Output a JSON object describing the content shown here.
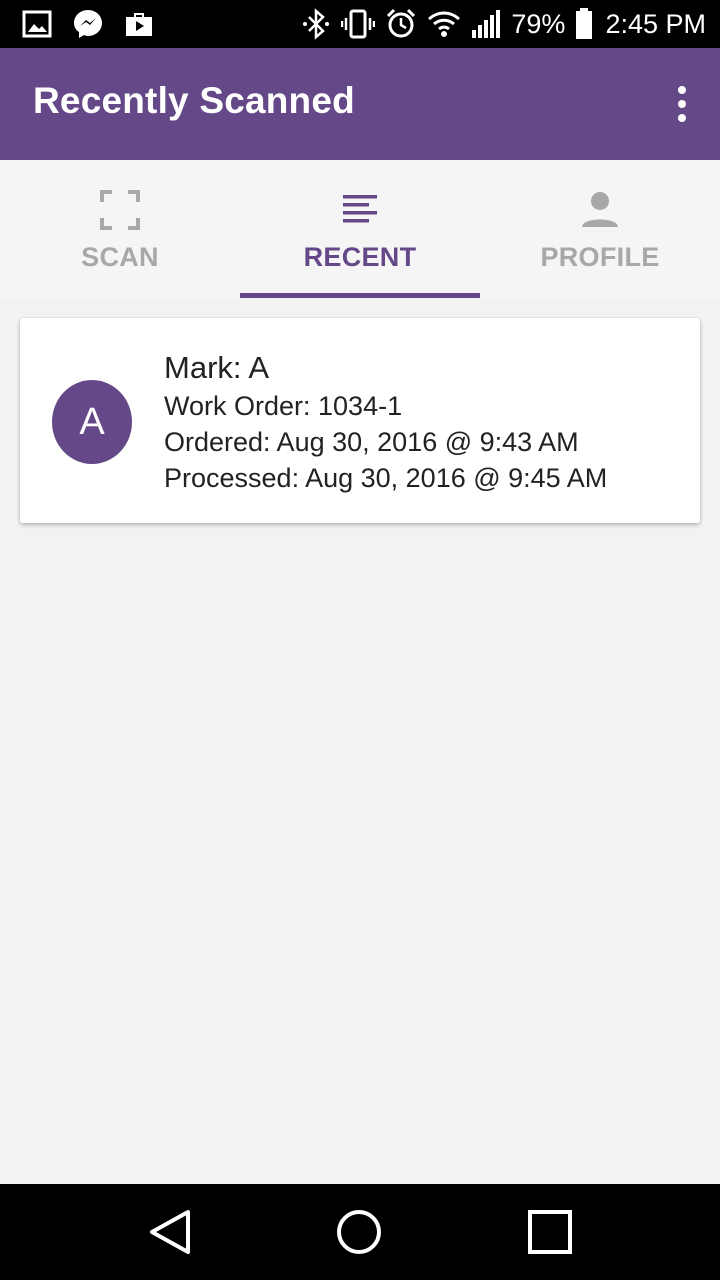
{
  "status_bar": {
    "battery_percent": "79%",
    "time": "2:45 PM",
    "left_icons": [
      "gallery-icon",
      "messenger-icon",
      "play-store-icon"
    ],
    "right_icons": [
      "bluetooth-icon",
      "vibrate-icon",
      "alarm-icon",
      "wifi-icon",
      "signal-icon",
      "battery-icon"
    ]
  },
  "app_bar": {
    "title": "Recently Scanned",
    "menu_icon": "more-vert-icon"
  },
  "tabs": [
    {
      "label": "SCAN",
      "icon": "scan-frame-icon",
      "active": false
    },
    {
      "label": "RECENT",
      "icon": "list-lines-icon",
      "active": true
    },
    {
      "label": "PROFILE",
      "icon": "person-icon",
      "active": false
    }
  ],
  "recent_items": [
    {
      "avatar_letter": "A",
      "mark": "Mark: A",
      "work_order": "Work Order: 1034-1",
      "ordered": "Ordered: Aug 30, 2016 @ 9:43 AM",
      "processed": "Processed: Aug 30, 2016 @ 9:45 AM"
    }
  ],
  "nav_bar": {
    "buttons": [
      "back-icon",
      "home-icon",
      "recents-icon"
    ]
  },
  "colors": {
    "primary": "#644887",
    "status_bar": "#000000",
    "tab_bar": "#f5f5f5",
    "inactive_tab": "#a8a8a8",
    "background": "#f2f2f4"
  }
}
